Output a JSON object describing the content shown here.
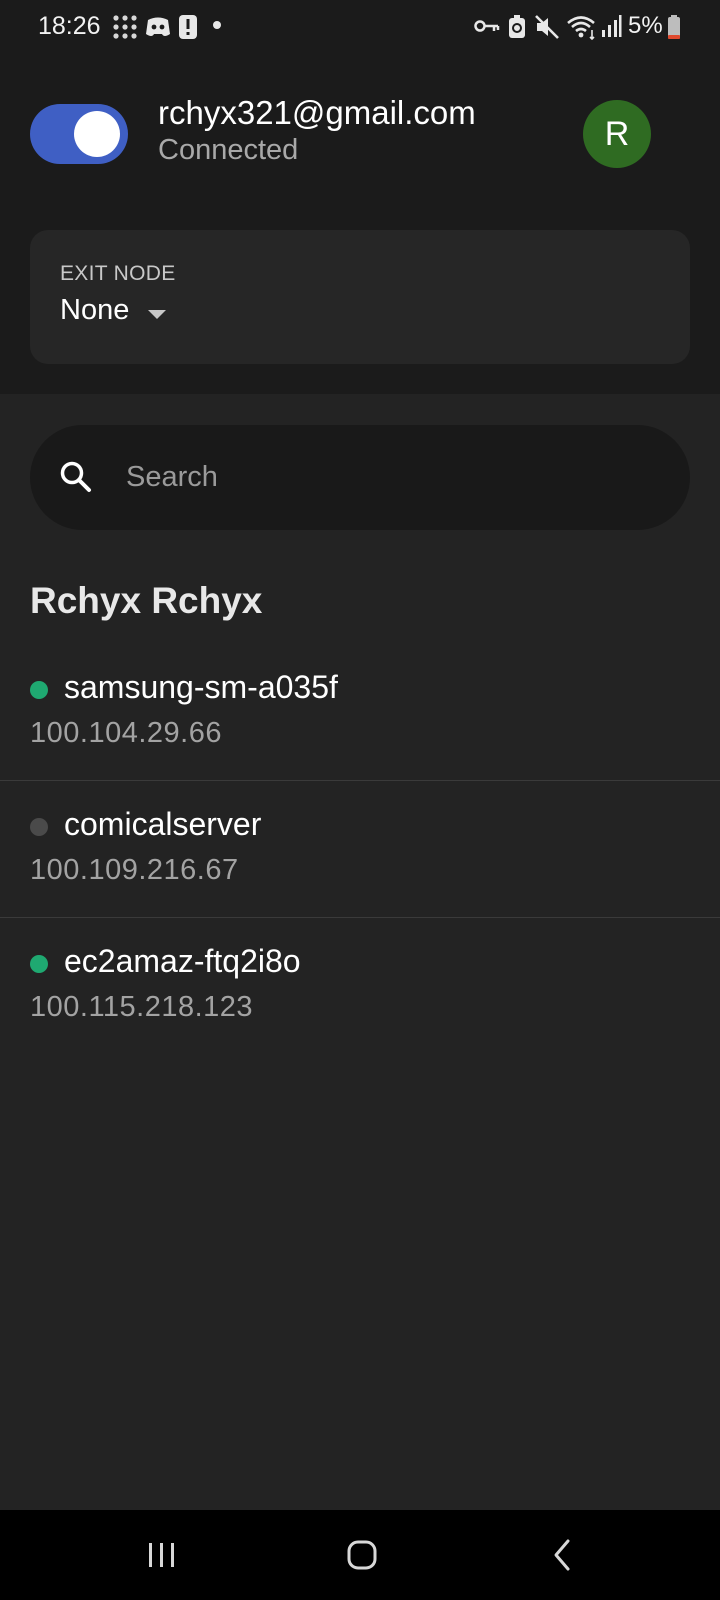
{
  "status_bar": {
    "time": "18:26",
    "battery": "5%",
    "icons": [
      "grid-dots-icon",
      "discord-icon",
      "alert-icon",
      "dot-icon",
      "vpn-key-icon",
      "sync-icon",
      "mute-icon",
      "wifi-icon",
      "signal-icon",
      "battery-icon"
    ],
    "battery_color": "#e04a2f"
  },
  "account": {
    "email": "rchyx321@gmail.com",
    "status": "Connected",
    "avatar_initial": "R",
    "toggle_on": true
  },
  "exit_node": {
    "label": "EXIT NODE",
    "value": "None"
  },
  "search": {
    "placeholder": "Search"
  },
  "owner": {
    "name": "Rchyx Rchyx"
  },
  "devices": [
    {
      "name": "samsung-sm-a035f",
      "ip": "100.104.29.66",
      "online": true
    },
    {
      "name": "comicalserver",
      "ip": "100.109.216.67",
      "online": false
    },
    {
      "name": "ec2amaz-ftq2i8o",
      "ip": "100.115.218.123",
      "online": true
    }
  ],
  "colors": {
    "accent": "#3f5fc4",
    "online": "#1fa971",
    "offline": "#4a4a4a",
    "avatar": "#2f6b22"
  },
  "nav": [
    "recents-icon",
    "home-icon",
    "back-icon"
  ]
}
